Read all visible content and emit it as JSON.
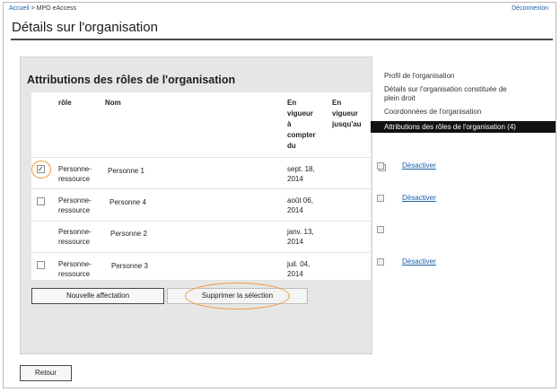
{
  "header": {
    "breadcrumb_home": "Accueil",
    "breadcrumb_sep": ">",
    "breadcrumb_current": "MPO eAccess",
    "logout": "Déconnexion",
    "title": "Détails sur l'organisation"
  },
  "section": {
    "title": "Attributions des rôles de l'organisation"
  },
  "table": {
    "columns": {
      "role": "rôle",
      "nom": "Nom",
      "start_lines": [
        "En",
        "vigueur",
        "à",
        "compter",
        "du"
      ],
      "end_lines": [
        "En",
        "vigueur",
        "jusqu'au"
      ]
    },
    "rows": [
      {
        "role_l1": "Personne-",
        "role_l2": "ressource",
        "nom": "Personne 1",
        "start_l1": "sept. 18,",
        "start_l2": "2014",
        "action": "Désactiver",
        "checked": true
      },
      {
        "role_l1": "Personne-",
        "role_l2": "ressource",
        "nom": "Personne 4",
        "start_l1": "août 06,",
        "start_l2": "2014",
        "action": "Désactiver",
        "checked": false
      },
      {
        "role_l1": "Personne-",
        "role_l2": "ressource",
        "nom": "Personne 2",
        "start_l1": "janv. 13,",
        "start_l2": "2014",
        "action": "",
        "checked": false
      },
      {
        "role_l1": "Personne-",
        "role_l2": "ressource",
        "nom": "Personne 3",
        "start_l1": "juil. 04,",
        "start_l2": "2014",
        "action": "Désactiver",
        "checked": false
      }
    ]
  },
  "buttons": {
    "new": "Nouvelle affectation",
    "delete": "Supprimer la sélection",
    "back": "Retour"
  },
  "side_nav": {
    "items": [
      {
        "label": "Profil de l'organisation"
      },
      {
        "label_l1": "Détails sur l'organisation constituée de",
        "label_l2": "plein droit"
      },
      {
        "label": "Coordonnées de l'organisation"
      },
      {
        "label": "Attributions des rôles de l'organisation (4)",
        "active": true
      }
    ]
  },
  "colors": {
    "accent_link": "#1a5fa8",
    "highlight_ring": "#f29a3a",
    "active_nav_bg": "#111111"
  }
}
